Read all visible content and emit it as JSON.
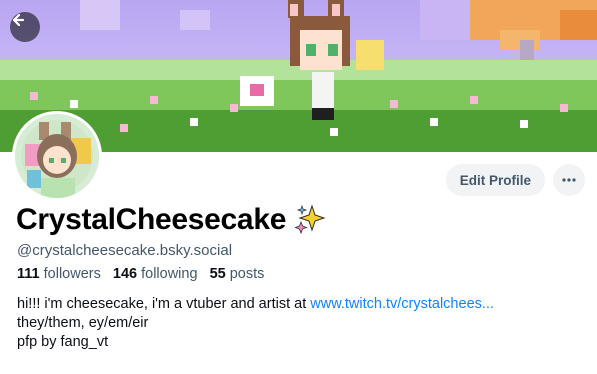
{
  "profile": {
    "display_name": "CrystalCheesecake",
    "handle": "@crystalcheesecake.bsky.social",
    "followers_count": "111",
    "followers_label": "followers",
    "following_count": "146",
    "following_label": "following",
    "posts_count": "55",
    "posts_label": "posts",
    "bio_line1_text": "hi!!! i'm cheesecake, i'm a vtuber and artist at ",
    "bio_link": "www.twitch.tv/crystalchees...",
    "bio_line2": "they/them, ey/em/eir",
    "bio_line3": "pfp by fang_vt"
  },
  "actions": {
    "edit_profile": "Edit Profile"
  },
  "icons": {
    "back": "arrow-left-icon",
    "more": "ellipsis-icon",
    "sparkles": "sparkles-icon"
  },
  "colors": {
    "link": "#1083fe",
    "secondary_text": "#42576c",
    "button_bg": "#f1f3f5"
  }
}
